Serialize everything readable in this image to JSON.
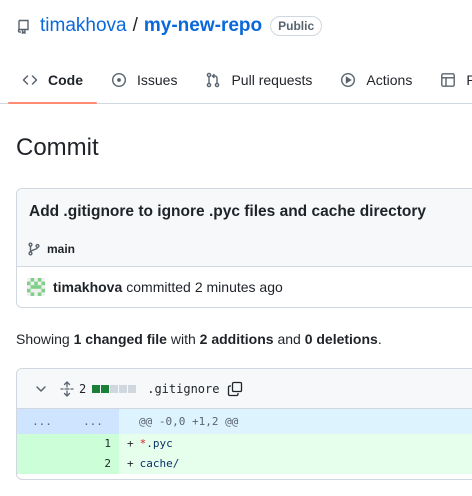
{
  "repo": {
    "owner": "timakhova",
    "separator": "/",
    "name": "my-new-repo",
    "visibility": "Public"
  },
  "tabs": [
    {
      "label": "Code",
      "icon": "code-icon",
      "active": true
    },
    {
      "label": "Issues",
      "icon": "issue-opened-icon"
    },
    {
      "label": "Pull requests",
      "icon": "git-pull-request-icon"
    },
    {
      "label": "Actions",
      "icon": "play-icon"
    },
    {
      "label": "Pr",
      "icon": "table-icon"
    }
  ],
  "page": {
    "title": "Commit"
  },
  "commit": {
    "message": "Add .gitignore to ignore .pyc files and cache directory",
    "branch": "main",
    "author": "timakhova",
    "action": "committed",
    "time": "2 minutes ago"
  },
  "summary": {
    "prefix": "Showing",
    "changed": "1 changed file",
    "with": "with",
    "additions": "2 additions",
    "and": "and",
    "deletions": "0 deletions",
    "suffix": "."
  },
  "diff": {
    "count": "2",
    "file": ".gitignore",
    "hunk_left": "...",
    "hunk_right": "...",
    "hunk_header": "@@ -0,0 +1,2 @@",
    "lines": [
      {
        "num": "1",
        "sign": "+",
        "prefix": "*",
        "text": ".pyc"
      },
      {
        "num": "2",
        "sign": "+",
        "prefix": "",
        "text": "cache/"
      }
    ],
    "stat_blocks": [
      "add",
      "add",
      "neutral",
      "neutral",
      "neutral"
    ]
  },
  "colors": {
    "link": "#0969da",
    "tab_underline": "#fd8c73",
    "addition_bg": "#e6ffec",
    "hunk_bg": "#ddf4ff"
  }
}
